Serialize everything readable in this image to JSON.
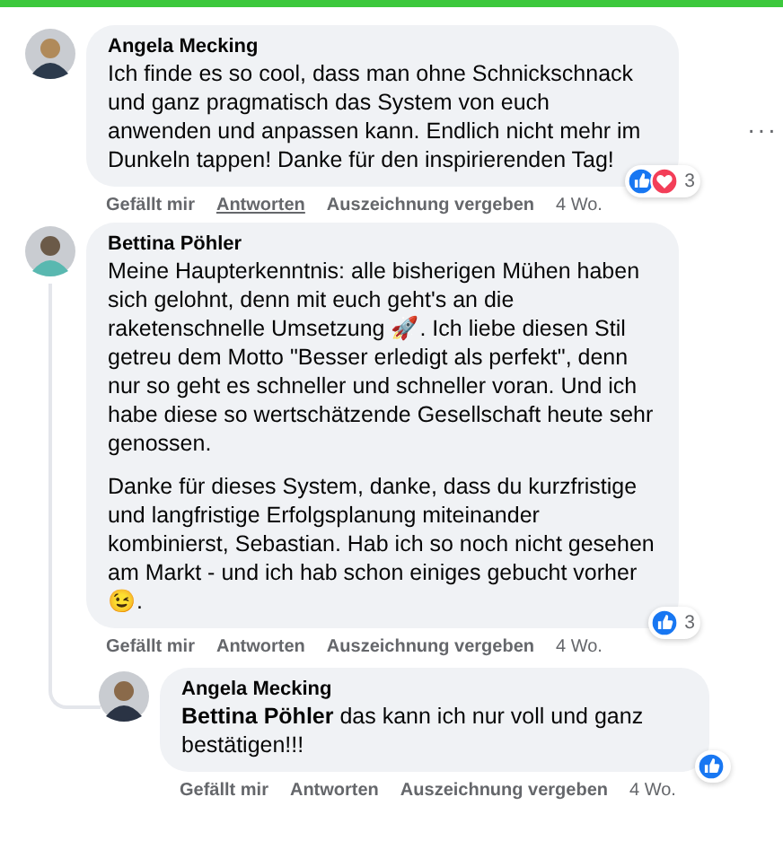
{
  "comments": [
    {
      "author": "Angela Mecking",
      "body": [
        "Ich finde es so cool, dass man ohne Schnickschnack und ganz pragmatisch das System von euch anwenden und anpassen kann. Endlich nicht mehr im Dunkeln tappen! Danke für den inspirierenden Tag!"
      ],
      "reactions": [
        {
          "kind": "like"
        },
        {
          "kind": "love"
        }
      ],
      "reaction_count": "3",
      "menu": "···",
      "actions": [
        {
          "label": "Gefällt mir",
          "hovered": false
        },
        {
          "label": "Antworten",
          "hovered": true
        },
        {
          "label": "Auszeichnung vergeben",
          "hovered": false
        }
      ],
      "time": "4 Wo."
    },
    {
      "author": "Bettina Pöhler",
      "body": [
        "Meine Haupterkenntnis: alle bisherigen Mühen haben sich gelohnt, denn mit euch geht's an die raketenschnelle Umsetzung 🚀. Ich liebe diesen Stil getreu dem Motto \"Besser erledigt als perfekt\", denn nur so geht es schneller und schneller voran. Und ich habe diese so wertschätzende Gesellschaft heute sehr genossen.",
        "Danke für dieses System, danke, dass du kurzfristige und langfristige Erfolgsplanung miteinander kombinierst, Sebastian. Hab ich so noch nicht gesehen am Markt - und ich hab schon einiges gebucht vorher 😉."
      ],
      "reactions": [
        {
          "kind": "like"
        }
      ],
      "reaction_count": "3",
      "actions": [
        {
          "label": "Gefällt mir",
          "hovered": false
        },
        {
          "label": "Antworten",
          "hovered": false
        },
        {
          "label": "Auszeichnung vergeben",
          "hovered": false
        }
      ],
      "time": "4 Wo.",
      "children": [
        {
          "author": "Angela Mecking",
          "body": [
            "**Bettina Pöhler** das kann ich nur voll und ganz bestätigen!!!"
          ],
          "reactions": [
            {
              "kind": "like"
            }
          ],
          "actions": [
            {
              "label": "Gefällt mir",
              "hovered": false
            },
            {
              "label": "Antworten",
              "hovered": false
            },
            {
              "label": "Auszeichnung vergeben",
              "hovered": false
            }
          ],
          "time": "4 Wo."
        }
      ]
    }
  ]
}
